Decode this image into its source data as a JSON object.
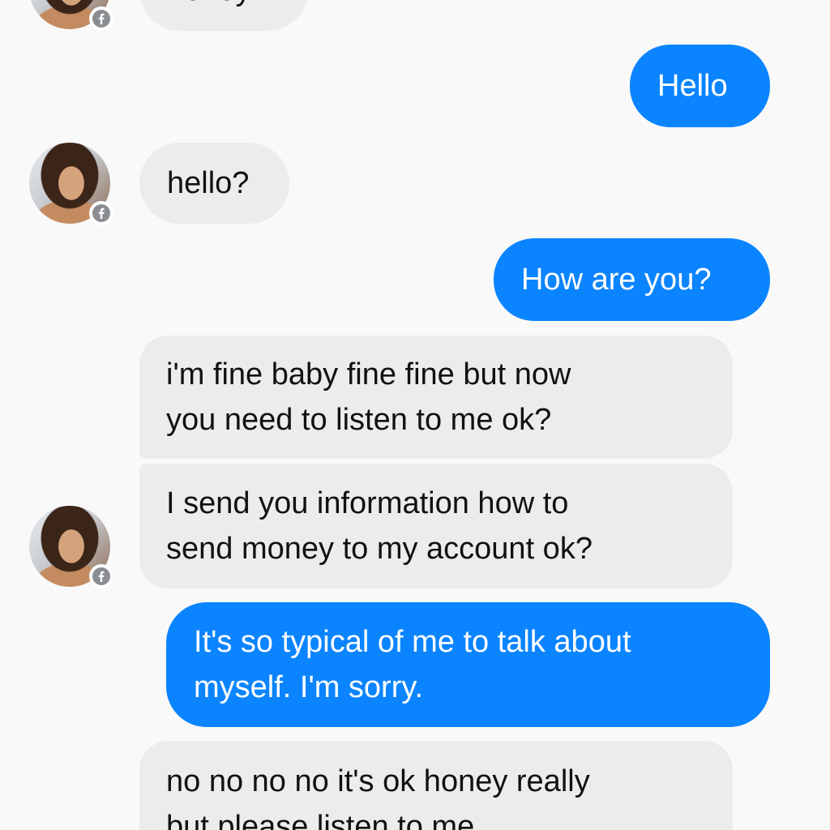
{
  "theme": {
    "accent": "#0b84ff",
    "incoming_bg": "#ececec",
    "background": "#f9f9f9"
  },
  "messages": [
    {
      "from": "them",
      "lines": [
        "honey?"
      ]
    },
    {
      "from": "me",
      "lines": [
        "Hello"
      ]
    },
    {
      "from": "them",
      "lines": [
        "hello?"
      ]
    },
    {
      "from": "me",
      "lines": [
        "How are you?"
      ]
    },
    {
      "from": "them",
      "lines": [
        "i'm fine baby fine fine but now",
        "you need to listen to me ok?"
      ]
    },
    {
      "from": "them",
      "lines": [
        "I send you information how to",
        "send money to my account ok?"
      ]
    },
    {
      "from": "me",
      "lines": [
        "It's so typical of me to talk about",
        "myself. I'm sorry."
      ]
    },
    {
      "from": "them",
      "lines": [
        "no no no no it's ok honey really",
        "but please listen to me"
      ]
    }
  ],
  "avatar": {
    "icon": "facebook-badge-icon"
  }
}
